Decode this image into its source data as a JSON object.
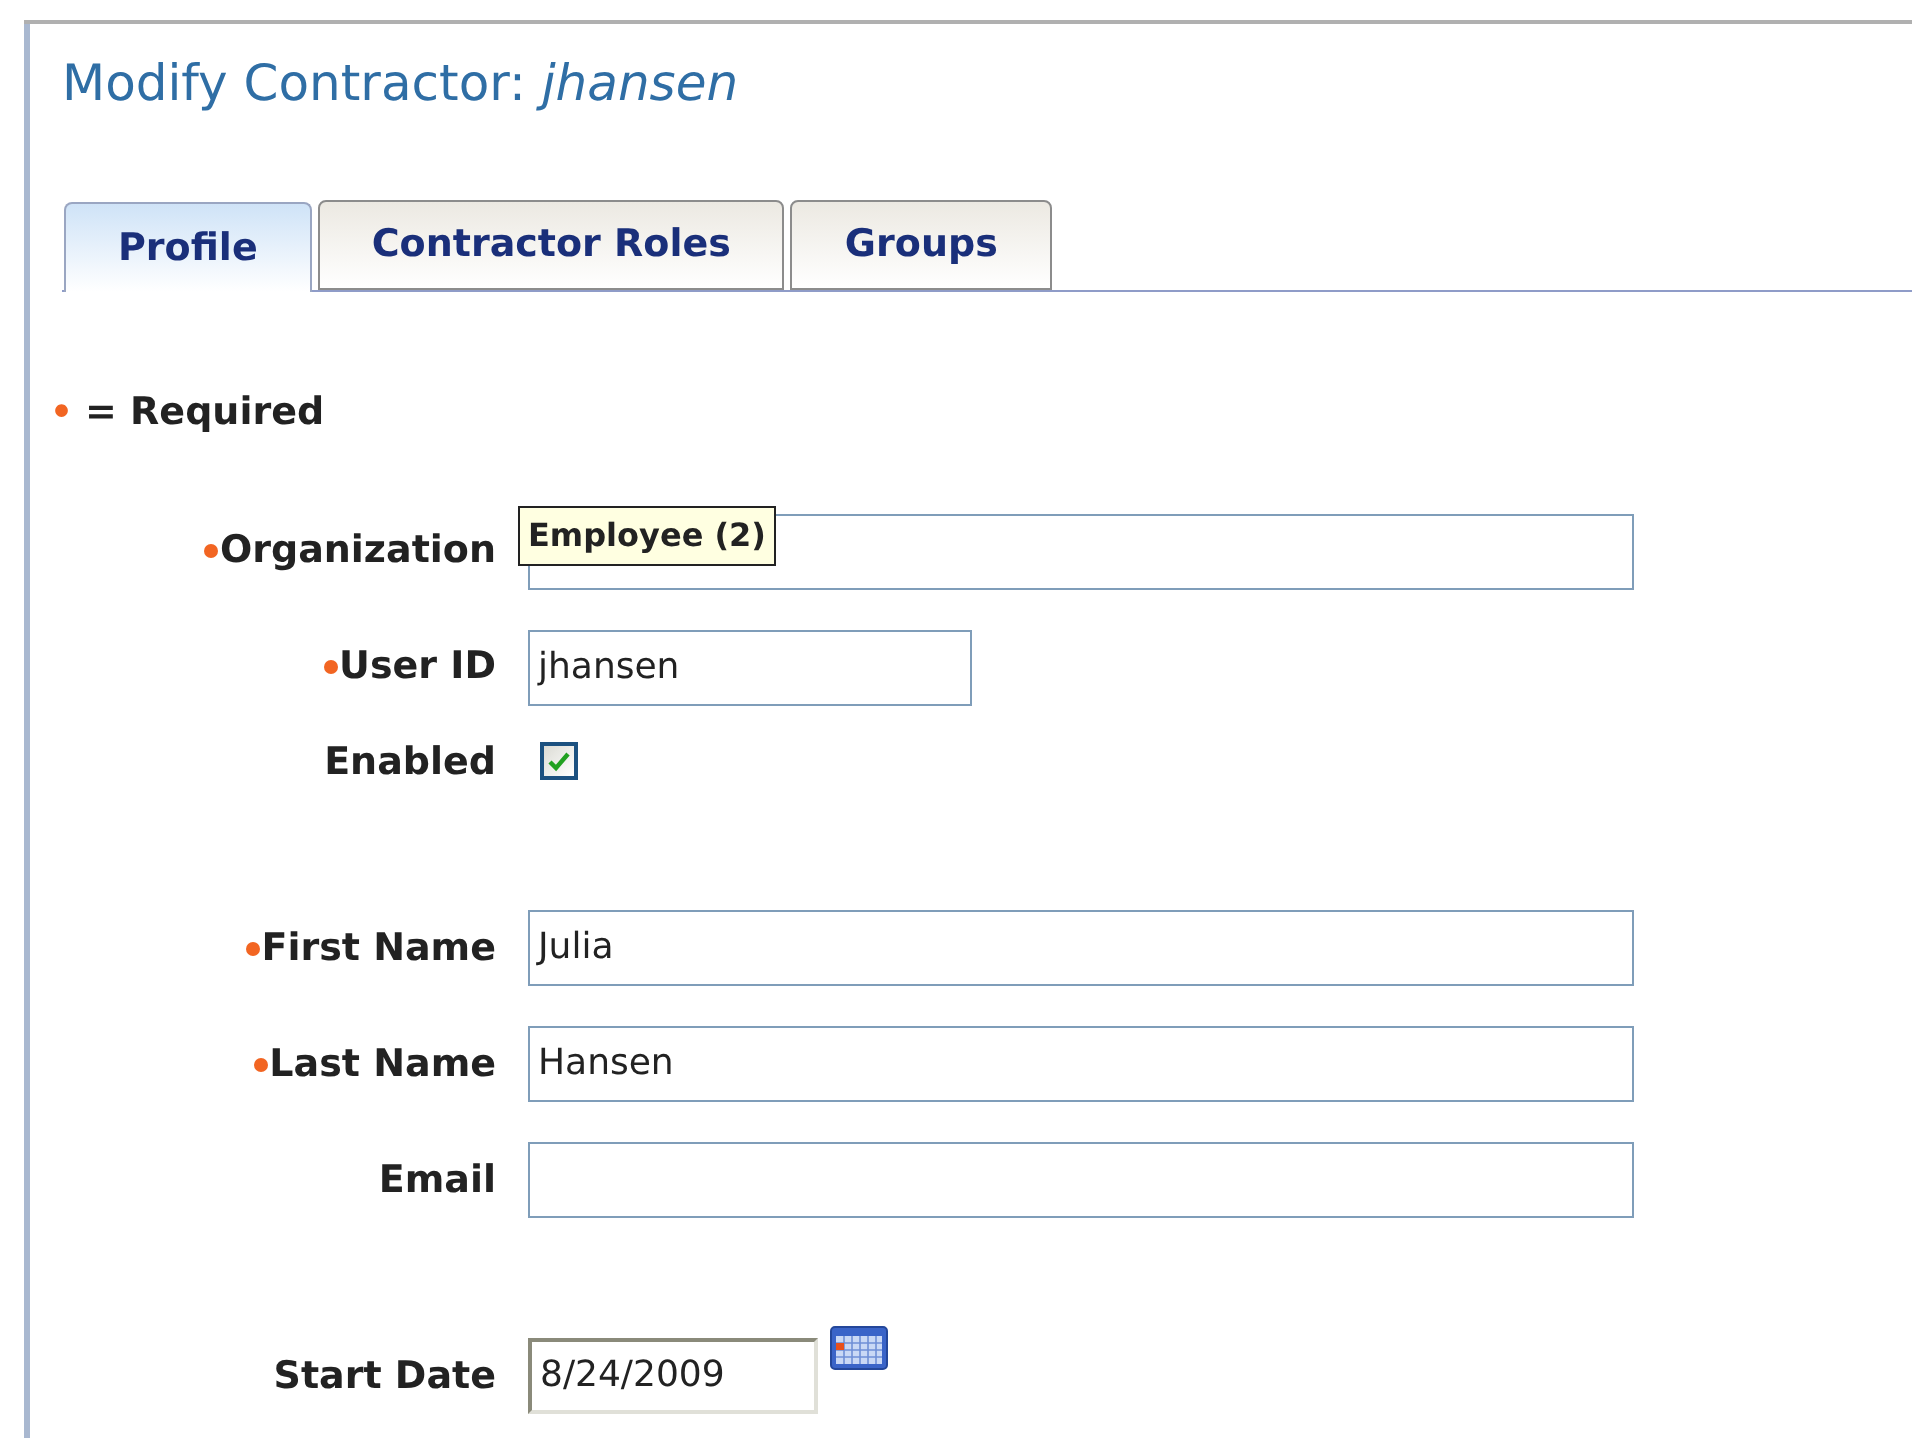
{
  "page": {
    "title": "Modify Contractor: *jhansen*"
  },
  "tabs": [
    {
      "label": "Profile",
      "selected": true
    },
    {
      "label": "Contractor Roles",
      "selected": false
    },
    {
      "label": "Groups",
      "selected": false
    }
  ],
  "required_note": {
    "mark": "•",
    "text": "= Required"
  },
  "sections": [
    {
      "fields": [
        {
          "kind": "text",
          "label": "Organization",
          "required": true,
          "tooltip": "Employee (2)"
        },
        {
          "kind": "short_text",
          "label": "User ID",
          "required": true,
          "value": "jhansen"
        },
        {
          "kind": "checkbox",
          "label": "Enabled",
          "required": false,
          "checked": true
        }
      ]
    },
    {
      "fields": [
        {
          "kind": "text",
          "label": "First Name",
          "required": true,
          "value": "Julia"
        },
        {
          "kind": "text",
          "label": "Last Name",
          "required": true,
          "value": "Hansen"
        },
        {
          "kind": "text",
          "label": "Email",
          "required": false
        }
      ]
    },
    {
      "fields": [
        {
          "kind": "date",
          "label": "Start Date",
          "required": false,
          "value": "8/24/2009"
        }
      ]
    }
  ]
}
